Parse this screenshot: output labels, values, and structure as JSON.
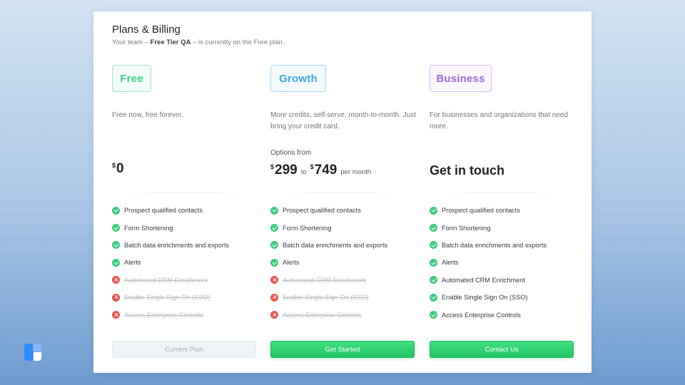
{
  "header": {
    "title": "Plans & Billing",
    "subtitle_prefix": "Your team –",
    "team_name": "Free Tier QA",
    "subtitle_suffix": "– is currently on the Free plan."
  },
  "plans": [
    {
      "name": "Free",
      "description": "Free now, free forever.",
      "price": {
        "currency": "$",
        "amount": "0"
      },
      "features": [
        {
          "label": "Prospect qualified contacts",
          "included": true
        },
        {
          "label": "Form Shortening",
          "included": true
        },
        {
          "label": "Batch data enrichments and exports",
          "included": true
        },
        {
          "label": "Alerts",
          "included": true
        },
        {
          "label": "Automated CRM Enrichment",
          "included": false
        },
        {
          "label": "Enable Single Sign On (SSO)",
          "included": false
        },
        {
          "label": "Access Enterprise Controls",
          "included": false
        }
      ],
      "button_label": "Current Plan"
    },
    {
      "name": "Growth",
      "description": "More credits, self-serve, month-to-month. Just bring your credit card.",
      "options_label": "Options from",
      "price": {
        "currency": "$",
        "low": "299",
        "to": "to",
        "high": "749",
        "period": "per month"
      },
      "features": [
        {
          "label": "Prospect qualified contacts",
          "included": true
        },
        {
          "label": "Form Shortening",
          "included": true
        },
        {
          "label": "Batch data enrichments and exports",
          "included": true
        },
        {
          "label": "Alerts",
          "included": true
        },
        {
          "label": "Automated CRM Enrichment",
          "included": false
        },
        {
          "label": "Enable Single Sign On (SSO)",
          "included": false
        },
        {
          "label": "Access Enterprise Controls",
          "included": false
        }
      ],
      "button_label": "Get Started"
    },
    {
      "name": "Business",
      "description": "For businesses and organizations that need more.",
      "price_text": "Get in touch",
      "features": [
        {
          "label": "Prospect qualified contacts",
          "included": true
        },
        {
          "label": "Form Shortening",
          "included": true
        },
        {
          "label": "Batch data enrichments and exports",
          "included": true
        },
        {
          "label": "Alerts",
          "included": true
        },
        {
          "label": "Automated CRM Enrichment",
          "included": true
        },
        {
          "label": "Enable Single Sign On (SSO)",
          "included": true
        },
        {
          "label": "Access Enterprise Controls",
          "included": true
        }
      ],
      "button_label": "Contact Us"
    }
  ],
  "icons": {
    "included": "check-circle-icon",
    "excluded": "x-circle-icon",
    "app_logo": "app-logo-icon"
  },
  "colors": {
    "free_accent": "#3ccf86",
    "growth_accent": "#3aa7e6",
    "business_accent": "#9c6ad9",
    "primary_button": "#2ad36f",
    "check": "#3fcb7e",
    "cross": "#e8574f"
  }
}
